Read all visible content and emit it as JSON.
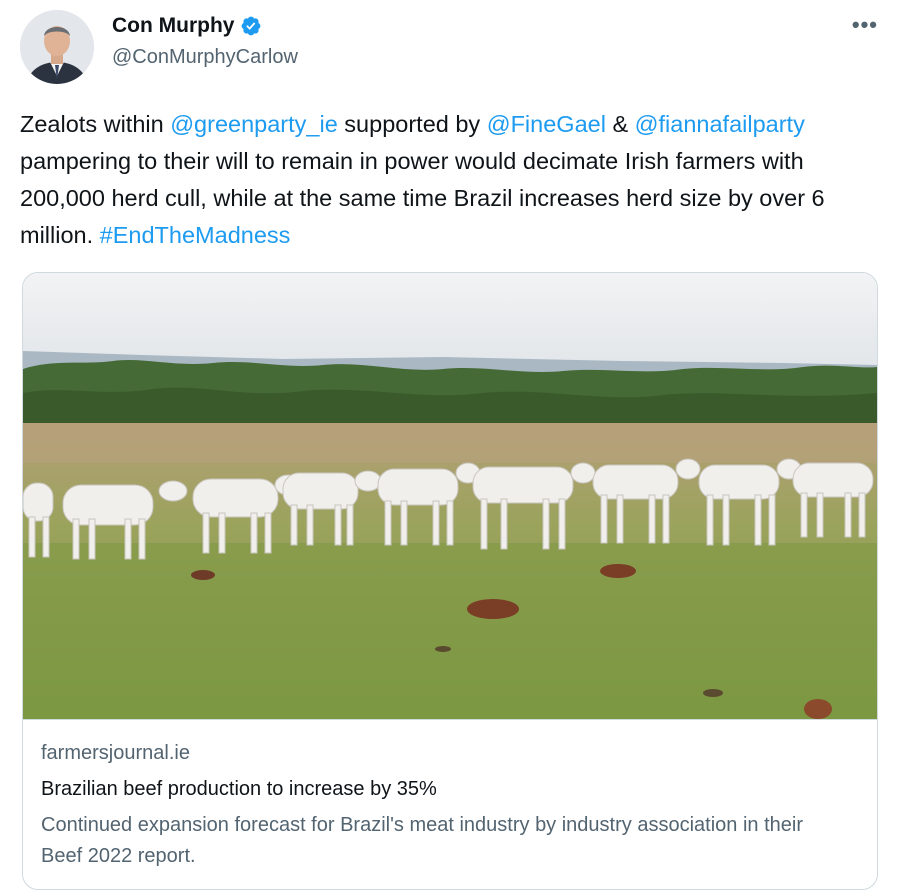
{
  "tweet": {
    "author": {
      "name": "Con Murphy",
      "handle": "@ConMurphyCarlow",
      "verified": true,
      "avatar_icon": "profile-photo"
    },
    "more_label": "•••",
    "text": {
      "p1": "Zealots within ",
      "mention1": "@greenparty_ie",
      "p2": " supported by ",
      "mention2": "@FineGael",
      "p3": " & ",
      "mention3": "@fiannafailparty",
      "p4": " pampering to their will to remain in power would decimate Irish farmers with 200,000 herd cull, while at the same time Brazil increases herd size by over 6 million. ",
      "hashtag": "#EndTheMadness"
    },
    "card": {
      "image_icon": "cattle-herd-photo",
      "domain": "farmersjournal.ie",
      "title": "Brazilian beef production to increase by 35%",
      "description": "Continued expansion forecast for Brazil's meat industry by industry association in their Beef 2022 report."
    }
  },
  "colors": {
    "link": "#1d9bf0",
    "text": "#0f1419",
    "secondary": "#536471",
    "border": "#cfd9de"
  }
}
